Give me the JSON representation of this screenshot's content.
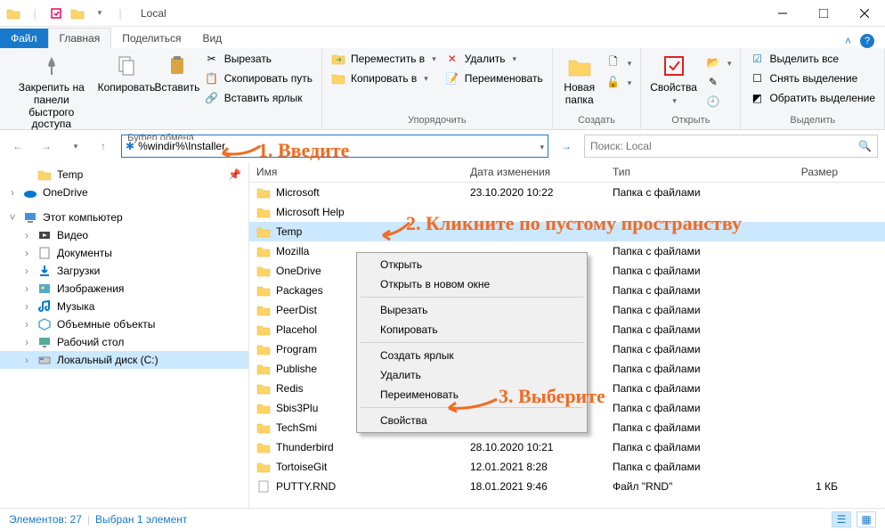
{
  "title": "Local",
  "tabs": {
    "file": "Файл",
    "home": "Главная",
    "share": "Поделиться",
    "view": "Вид"
  },
  "ribbon": {
    "clipboard": {
      "label": "Буфер обмена",
      "pin": "Закрепить на панели\nбыстрого доступа",
      "copy": "Копировать",
      "paste": "Вставить",
      "cut": "Вырезать",
      "copy_path": "Скопировать путь",
      "paste_shortcut": "Вставить ярлык"
    },
    "organize": {
      "label": "Упорядочить",
      "move_to": "Переместить в",
      "copy_to": "Копировать в",
      "delete": "Удалить",
      "rename": "Переименовать"
    },
    "new": {
      "label": "Создать",
      "new_folder": "Новая\nпапка"
    },
    "open": {
      "label": "Открыть",
      "properties": "Свойства"
    },
    "select": {
      "label": "Выделить",
      "select_all": "Выделить все",
      "select_none": "Снять выделение",
      "invert": "Обратить выделение"
    }
  },
  "address": {
    "value": "%windir%\\Installer"
  },
  "search": {
    "placeholder": "Поиск: Local"
  },
  "tree": [
    {
      "label": "Temp",
      "icon": "folder",
      "indent": 1,
      "pin": true
    },
    {
      "label": "OneDrive",
      "icon": "onedrive",
      "indent": 0,
      "twisty": ">"
    },
    {
      "label": "Этот компьютер",
      "icon": "pc",
      "indent": 0,
      "twisty": "v"
    },
    {
      "label": "Видео",
      "icon": "video",
      "indent": 1,
      "twisty": ">"
    },
    {
      "label": "Документы",
      "icon": "docs",
      "indent": 1,
      "twisty": ">"
    },
    {
      "label": "Загрузки",
      "icon": "downloads",
      "indent": 1,
      "twisty": ">"
    },
    {
      "label": "Изображения",
      "icon": "pictures",
      "indent": 1,
      "twisty": ">"
    },
    {
      "label": "Музыка",
      "icon": "music",
      "indent": 1,
      "twisty": ">"
    },
    {
      "label": "Объемные объекты",
      "icon": "3d",
      "indent": 1,
      "twisty": ">"
    },
    {
      "label": "Рабочий стол",
      "icon": "desktop",
      "indent": 1,
      "twisty": ">"
    },
    {
      "label": "Локальный диск (C:)",
      "icon": "disk",
      "indent": 1,
      "twisty": ">",
      "selected": true
    }
  ],
  "columns": {
    "name": "Имя",
    "date": "Дата изменения",
    "type": "Тип",
    "size": "Размер"
  },
  "rows": [
    {
      "name": "Microsoft",
      "date": "23.10.2020 10:22",
      "type": "Папка с файлами",
      "size": "",
      "icon": "folder"
    },
    {
      "name": "Microsoft Help",
      "date": "",
      "type": "",
      "size": "",
      "icon": "folder"
    },
    {
      "name": "Temp",
      "date": "",
      "type": "",
      "size": "",
      "icon": "folder",
      "selected": true
    },
    {
      "name": "Mozilla",
      "date": "",
      "type": "Папка с файлами",
      "size": "",
      "icon": "folder"
    },
    {
      "name": "OneDrive",
      "date": "",
      "type": "Папка с файлами",
      "size": "",
      "icon": "folder"
    },
    {
      "name": "Packages",
      "date": "",
      "type": "Папка с файлами",
      "size": "",
      "icon": "folder"
    },
    {
      "name": "PeerDist",
      "date": "",
      "type": "Папка с файлами",
      "size": "",
      "icon": "folder"
    },
    {
      "name": "Placehol",
      "date": "",
      "type": "Папка с файлами",
      "size": "",
      "icon": "folder"
    },
    {
      "name": "Program",
      "date": "",
      "type": "Папка с файлами",
      "size": "",
      "icon": "folder"
    },
    {
      "name": "Publishe",
      "date": "",
      "type": "Папка с файлами",
      "size": "",
      "icon": "folder"
    },
    {
      "name": "Redis",
      "date": "",
      "type": "Папка с файлами",
      "size": "",
      "icon": "folder"
    },
    {
      "name": "Sbis3Plu",
      "date": "",
      "type": "Папка с файлами",
      "size": "",
      "icon": "folder"
    },
    {
      "name": "TechSmi",
      "date": "",
      "type": "Папка с файлами",
      "size": "",
      "icon": "folder"
    },
    {
      "name": "Thunderbird",
      "date": "28.10.2020 10:21",
      "type": "Папка с файлами",
      "size": "",
      "icon": "folder"
    },
    {
      "name": "TortoiseGit",
      "date": "12.01.2021 8:28",
      "type": "Папка с файлами",
      "size": "",
      "icon": "folder"
    },
    {
      "name": "PUTTY.RND",
      "date": "18.01.2021 9:46",
      "type": "Файл \"RND\"",
      "size": "1 КБ",
      "icon": "file"
    }
  ],
  "context_menu": [
    {
      "label": "Открыть"
    },
    {
      "label": "Открыть в новом окне"
    },
    {
      "sep": true
    },
    {
      "label": "Вырезать"
    },
    {
      "label": "Копировать"
    },
    {
      "sep": true
    },
    {
      "label": "Создать ярлык"
    },
    {
      "label": "Удалить"
    },
    {
      "label": "Переименовать"
    },
    {
      "sep": true
    },
    {
      "label": "Свойства"
    }
  ],
  "status": {
    "count": "Элементов: 27",
    "selected": "Выбран 1 элемент"
  },
  "annotations": {
    "a1": "1. Введите",
    "a2": "2. Кликните по пустому пространству",
    "a3": "3. Выберите"
  }
}
